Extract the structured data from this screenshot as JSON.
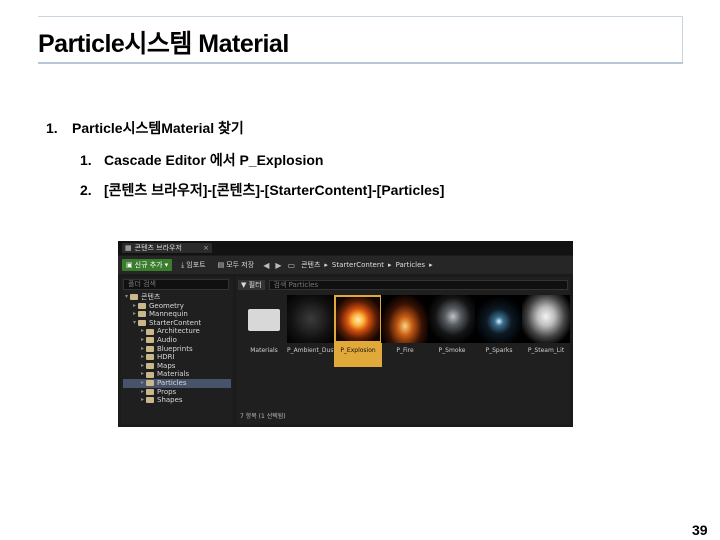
{
  "slide": {
    "title": "Particle시스템 Material",
    "steps": [
      {
        "num": "1.",
        "text": "Particle시스템Material 찾기"
      },
      {
        "num": "1.",
        "text": "Cascade Editor 에서 P_Explosion"
      },
      {
        "num": "2.",
        "text": "[콘텐츠 브라우저]-[콘텐츠]-[StarterContent]-[Particles]"
      }
    ],
    "page_number": "39"
  },
  "browser": {
    "tab_label": "콘텐츠 브라우저",
    "add_button": "신규 추가",
    "import_button": "임포트",
    "save_all_button": "모두 저장",
    "breadcrumbs": [
      "콘텐츠",
      "StarterContent",
      "Particles"
    ],
    "tree_search_placeholder": "폴더 검색",
    "filters_label": "필터",
    "asset_search_placeholder": "검색 Particles",
    "tree": [
      {
        "label": "콘텐츠",
        "level": 0,
        "open": true
      },
      {
        "label": "Geometry",
        "level": 1
      },
      {
        "label": "Mannequin",
        "level": 1
      },
      {
        "label": "StarterContent",
        "level": 1,
        "open": true
      },
      {
        "label": "Architecture",
        "level": 2
      },
      {
        "label": "Audio",
        "level": 2
      },
      {
        "label": "Blueprints",
        "level": 2
      },
      {
        "label": "HDRI",
        "level": 2
      },
      {
        "label": "Maps",
        "level": 2
      },
      {
        "label": "Materials",
        "level": 2
      },
      {
        "label": "Particles",
        "level": 2,
        "selected": true
      },
      {
        "label": "Props",
        "level": 2
      },
      {
        "label": "Shapes",
        "level": 2
      }
    ],
    "assets": [
      {
        "label": "Materials",
        "kind": "folder"
      },
      {
        "label": "P_Ambient_Dust",
        "kind": "ambient"
      },
      {
        "label": "P_Explosion",
        "kind": "explosion",
        "selected": true
      },
      {
        "label": "P_Fire",
        "kind": "fire"
      },
      {
        "label": "P_Smoke",
        "kind": "smoke"
      },
      {
        "label": "P_Sparks",
        "kind": "sparks"
      },
      {
        "label": "P_Steam_Lit",
        "kind": "steam"
      }
    ],
    "status": "7 항목 (1 선택됨)",
    "colors": {
      "selection": "#e1a93a",
      "add_button": "#3a7d2c",
      "tree_selection": "#47536a"
    }
  }
}
